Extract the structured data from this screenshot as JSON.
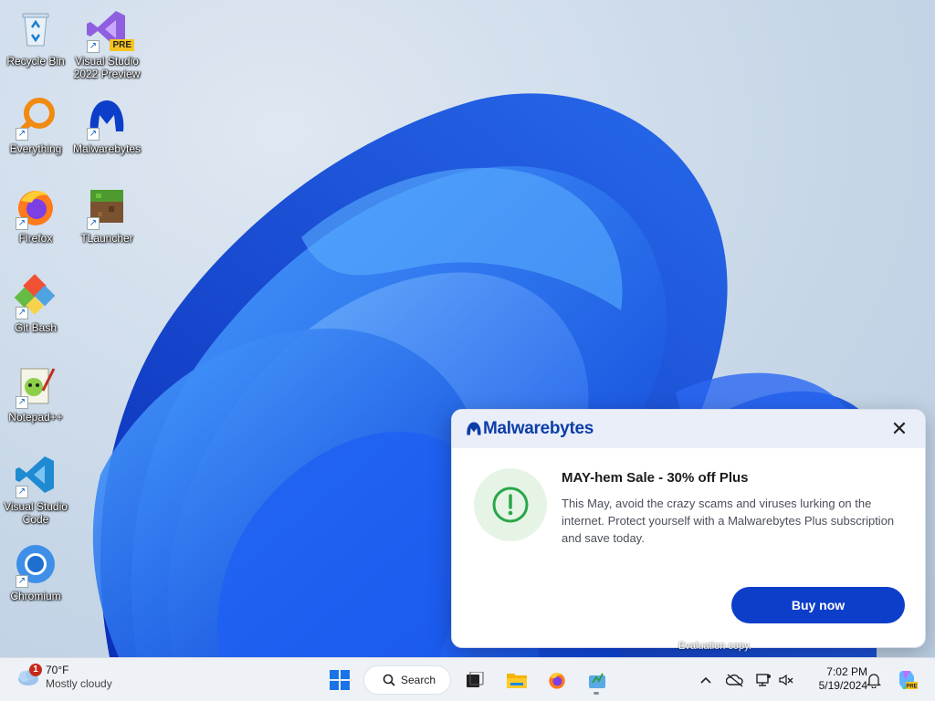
{
  "desktop": {
    "icons": [
      {
        "label": "Recycle Bin",
        "icon": "recycle-bin-icon"
      },
      {
        "label": "Visual Studio 2022 Preview",
        "icon": "visual-studio-preview-icon",
        "badge": "PRE"
      },
      {
        "label": "Everything",
        "icon": "everything-search-icon"
      },
      {
        "label": "Malwarebytes",
        "icon": "malwarebytes-icon"
      },
      {
        "label": "Firefox",
        "icon": "firefox-icon"
      },
      {
        "label": "TLauncher",
        "icon": "tlauncher-icon"
      },
      {
        "label": "Git Bash",
        "icon": "git-bash-icon"
      },
      {
        "label": "Notepad++",
        "icon": "notepad-plus-plus-icon"
      },
      {
        "label": "Visual Studio Code",
        "icon": "vscode-icon"
      },
      {
        "label": "Chromium",
        "icon": "chromium-icon"
      }
    ]
  },
  "toast": {
    "brand": "Malwarebytes",
    "title": "MAY-hem Sale - 30% off Plus",
    "message": "This May, avoid the crazy scams and viruses lurking on the internet. Protect yourself with a Malwarebytes Plus subscription and save today.",
    "button": "Buy now",
    "close": "✕",
    "accent": "#0d3ec9"
  },
  "watermark": "Evaluation copy.",
  "taskbar": {
    "weather": {
      "temp": "70°F",
      "condition": "Mostly cloudy",
      "badge": "1"
    },
    "search_label": "Search",
    "clock": {
      "time": "7:02 PM",
      "date": "5/19/2024"
    }
  }
}
